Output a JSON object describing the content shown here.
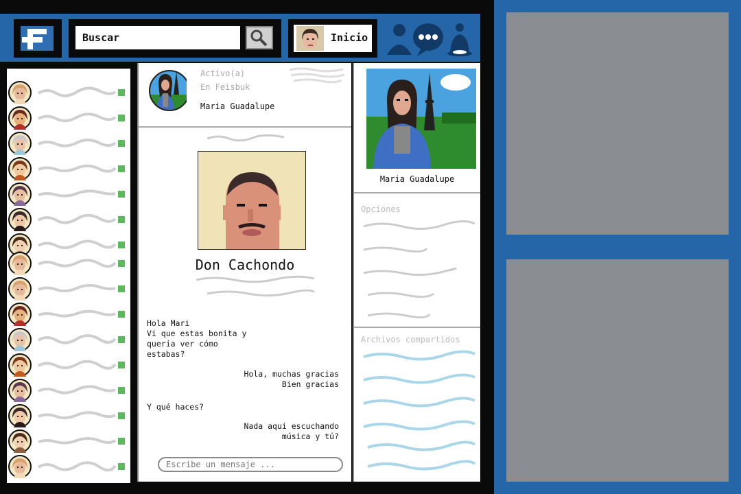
{
  "brand": {
    "logo_icon": "feisbuk-logo-icon",
    "accent": "#2566a8"
  },
  "search": {
    "placeholder": "",
    "value": "Buscar",
    "icon": "magnifier-icon"
  },
  "home": {
    "label": "Inicio",
    "avatar": "user-avatar-icon"
  },
  "top_icons": [
    "friends-icon",
    "messages-icon",
    "notifications-icon"
  ],
  "friends": {
    "online_color": "#5cb85c",
    "items": [
      {
        "avatar": "friend-avatar-icon"
      },
      {
        "avatar": "friend-avatar-icon"
      },
      {
        "avatar": "friend-avatar-icon"
      },
      {
        "avatar": "friend-avatar-icon"
      },
      {
        "avatar": "friend-avatar-icon"
      },
      {
        "avatar": "friend-avatar-icon"
      },
      {
        "avatar": "friend-avatar-icon"
      },
      {
        "avatar": "friend-avatar-icon"
      },
      {
        "avatar": "friend-avatar-icon"
      },
      {
        "avatar": "friend-avatar-icon"
      },
      {
        "avatar": "friend-avatar-icon"
      },
      {
        "avatar": "friend-avatar-icon"
      },
      {
        "avatar": "friend-avatar-icon"
      },
      {
        "avatar": "friend-avatar-icon"
      },
      {
        "avatar": "friend-avatar-icon"
      },
      {
        "avatar": "friend-avatar-icon"
      }
    ]
  },
  "chat": {
    "status_line1": "Activo(a)",
    "status_line2": "En Feisbuk",
    "contact_name": "Maria Guadalupe",
    "profile_name": "Don Cachondo",
    "messages": [
      {
        "side": "left",
        "text": "Hola Mari\nVi que estas bonita y\nqueria ver cómo\nestabas?"
      },
      {
        "side": "right",
        "text": "Hola, muchas gracias\nBien gracias"
      },
      {
        "side": "left",
        "text": "Y qué haces?"
      },
      {
        "side": "right",
        "text": "Nada aquí escuchando\nmúsica y tú?"
      }
    ],
    "composer_placeholder": "Escribe un mensaje ..."
  },
  "profile_panel": {
    "name": "Maria Guadalupe",
    "options_title": "Opciones",
    "files_title": "Archivos compartidos"
  }
}
